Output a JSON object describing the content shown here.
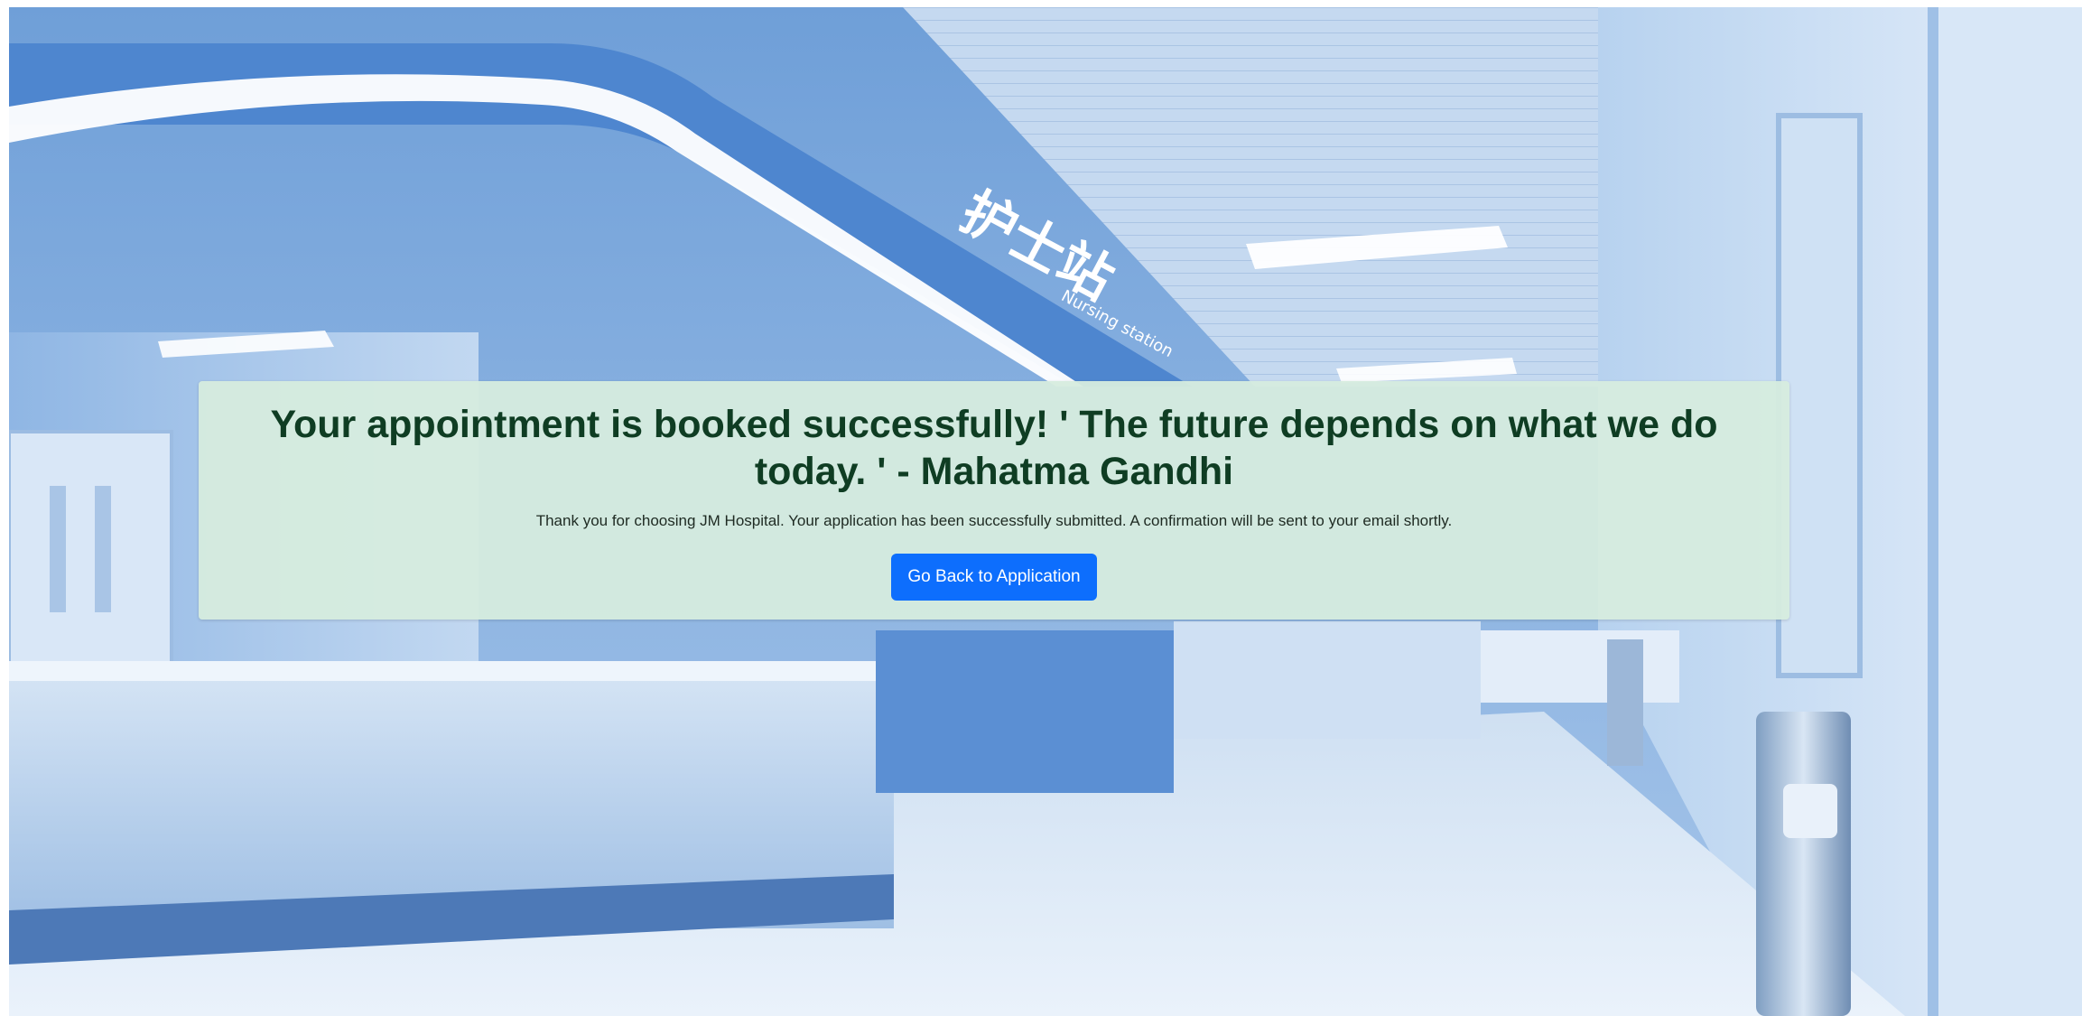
{
  "confirmation": {
    "heading": "Your appointment is booked successfully! ' The future depends on what we do today. ' - Mahatma Gandhi",
    "message": "Thank you for choosing JM Hospital. Your application has been successfully submitted. A confirmation will be sent to your email shortly.",
    "back_button_label": "Go Back to Application"
  },
  "background": {
    "sign_text": "护士站",
    "sign_subtext": "Nursing station"
  },
  "colors": {
    "card_background": "#d6ecde",
    "heading_text": "#0f3d23",
    "button_background": "#0d6efd",
    "button_text": "#ffffff"
  }
}
